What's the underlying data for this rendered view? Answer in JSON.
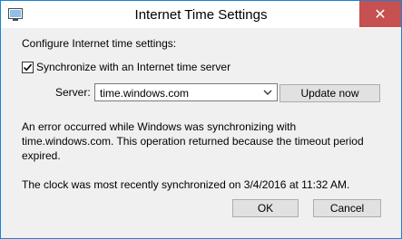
{
  "window": {
    "title": "Internet Time Settings",
    "close_glyph": "✕"
  },
  "dialog": {
    "configure_label": "Configure Internet time settings:",
    "sync_checkbox_label": "Synchronize with an Internet time server",
    "sync_checked": true,
    "server_label": "Server:",
    "server_value": "time.windows.com",
    "update_button": "Update now",
    "error_line1": "An error occurred while Windows was synchronizing with",
    "error_line2": "time.windows.com.  This operation returned because the timeout period",
    "error_line3": "expired.",
    "last_sync_text": "The clock was most recently synchronized on 3/4/2016 at 11:32 AM.",
    "ok_button": "OK",
    "cancel_button": "Cancel"
  },
  "colors": {
    "border": "#1883d7",
    "close_bg": "#c75050",
    "client_bg": "#f0f0f0"
  },
  "icons": {
    "title": "clock-settings-icon",
    "close": "close-icon",
    "check": "checkmark-icon",
    "dropdown": "chevron-down-icon"
  }
}
